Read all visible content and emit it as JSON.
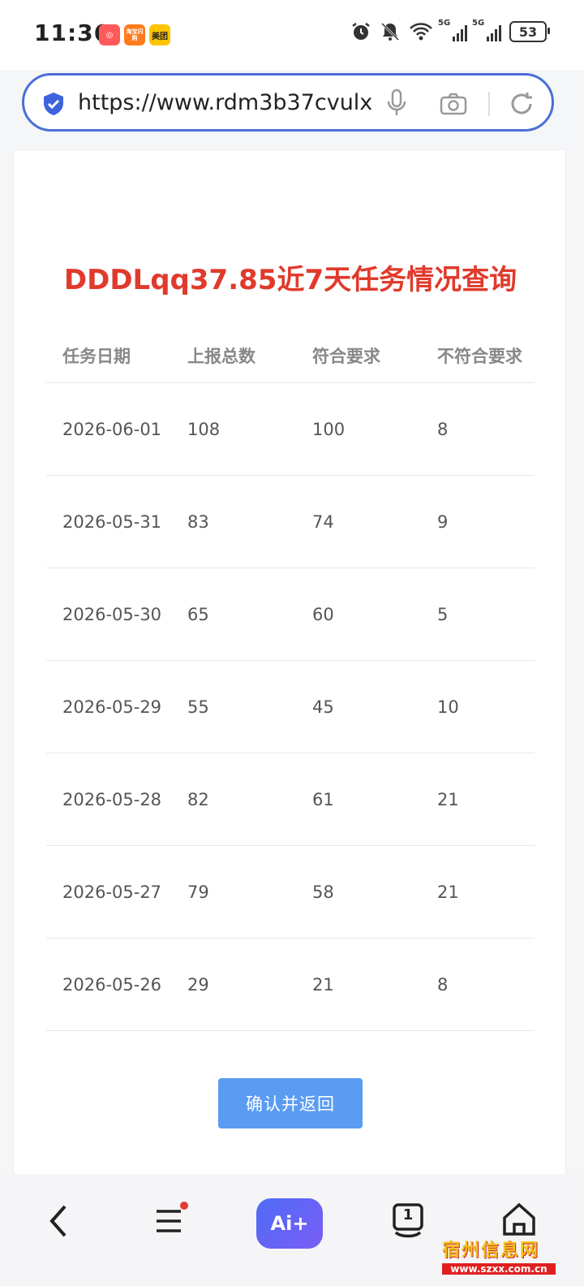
{
  "statusbar": {
    "time": "11:36",
    "apps": [
      {
        "name": "app-icon-1",
        "label": "",
        "color": "#ff5a5a"
      },
      {
        "name": "app-icon-taobao",
        "label": "淘宝闪购",
        "color": "#ff7a1a"
      },
      {
        "name": "app-icon-meituan",
        "label": "美团",
        "color": "#ffc300"
      }
    ],
    "signal_label_1": "5G",
    "signal_label_2": "5G",
    "battery": "53"
  },
  "browser": {
    "url": "https://www.rdm3b37cvulx"
  },
  "page": {
    "title": "DDDLqq37.85近7天任务情况查询",
    "table": {
      "headers": [
        "任务日期",
        "上报总数",
        "符合要求",
        "不符合要求"
      ],
      "rows": [
        {
          "date": "2026-06-01",
          "total": "108",
          "ok": "100",
          "fail": "8"
        },
        {
          "date": "2026-05-31",
          "total": "83",
          "ok": "74",
          "fail": "9"
        },
        {
          "date": "2026-05-30",
          "total": "65",
          "ok": "60",
          "fail": "5"
        },
        {
          "date": "2026-05-29",
          "total": "55",
          "ok": "45",
          "fail": "10"
        },
        {
          "date": "2026-05-28",
          "total": "82",
          "ok": "61",
          "fail": "21"
        },
        {
          "date": "2026-05-27",
          "total": "79",
          "ok": "58",
          "fail": "21"
        },
        {
          "date": "2026-05-26",
          "total": "29",
          "ok": "21",
          "fail": "8"
        }
      ]
    },
    "confirm_label": "确认并返回"
  },
  "navbar": {
    "ai_label": "Ai+",
    "tabs_count": "1"
  },
  "watermark": {
    "text": "宿州信息网",
    "sub": "www.szxx.com.cn"
  },
  "colors": {
    "title": "#e03a2c",
    "button": "#5a9cf2",
    "urlbar_border": "#4a6fd6"
  }
}
